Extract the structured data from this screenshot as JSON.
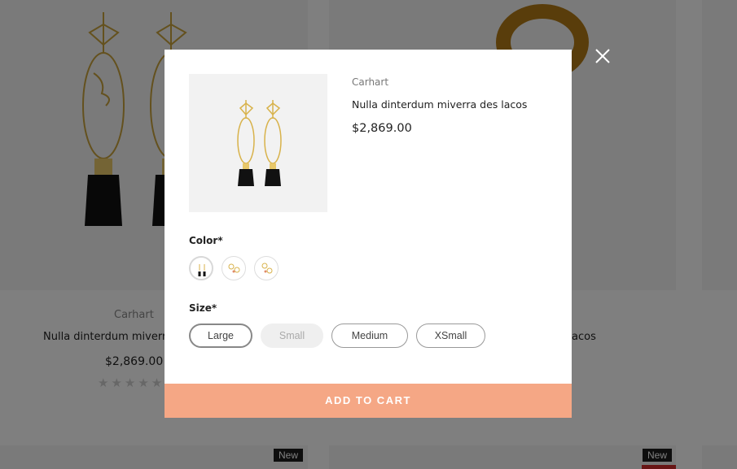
{
  "background": {
    "brand": "Carhart",
    "title": "Nulla dinterdum miverra des lacos",
    "title_tail": "acos",
    "price": "$2,869.00",
    "stars": "★★★★★",
    "badges": [
      "New",
      "New"
    ]
  },
  "modal": {
    "brand": "Carhart",
    "title": "Nulla dinterdum miverra des lacos",
    "price": "$2,869.00",
    "color_label": "Color",
    "size_label": "Size",
    "required_mark": "*",
    "sizes": [
      "Large",
      "Small",
      "Medium",
      "XSmall"
    ],
    "selected_size": "Large",
    "unavailable_size": "Small",
    "add_to_cart": "ADD TO CART"
  },
  "colors": {
    "accent": "#f5a785",
    "overlay": "rgba(0,0,0,0.5)",
    "gold": "#d8b24a",
    "tassel": "#111111"
  },
  "icons": {
    "close": "close-icon"
  }
}
